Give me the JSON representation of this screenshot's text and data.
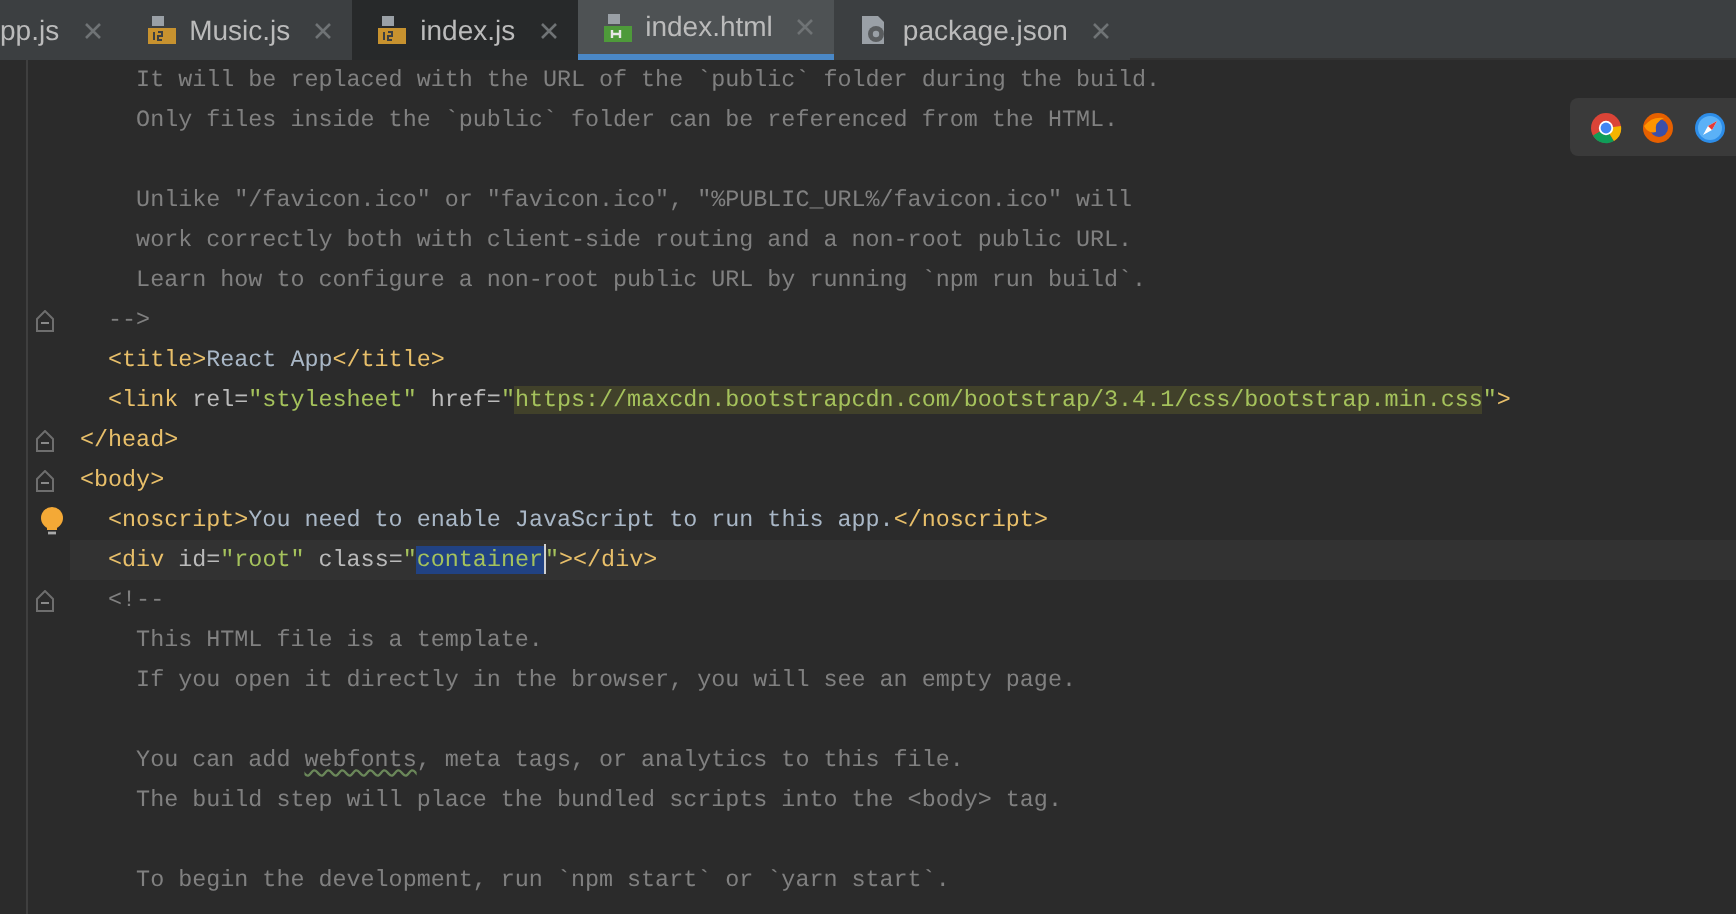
{
  "tabs": [
    {
      "label": "pp.js",
      "kind": "plain",
      "selected": false,
      "hovered": false
    },
    {
      "label": "Music.js",
      "kind": "js",
      "selected": false,
      "hovered": false
    },
    {
      "label": "index.js",
      "kind": "js",
      "selected": false,
      "hovered": true
    },
    {
      "label": "index.html",
      "kind": "html",
      "selected": true,
      "hovered": false
    },
    {
      "label": "package.json",
      "kind": "json",
      "selected": false,
      "hovered": false
    }
  ],
  "lines": [
    {
      "kind": "code",
      "segments": [
        {
          "kind": "comment",
          "text": "    It will be replaced with the URL of the `public` folder during the build."
        }
      ]
    },
    {
      "kind": "code",
      "segments": [
        {
          "kind": "comment",
          "text": "    Only files inside the `public` folder can be referenced from the HTML."
        }
      ]
    },
    {
      "kind": "blank"
    },
    {
      "kind": "code",
      "segments": [
        {
          "kind": "comment",
          "text": "    Unlike \"/favicon.ico\" or \"favicon.ico\", \"%PUBLIC_URL%/favicon.ico\" will"
        }
      ]
    },
    {
      "kind": "code",
      "segments": [
        {
          "kind": "comment",
          "text": "    work correctly both with client-side routing and a non-root public URL."
        }
      ]
    },
    {
      "kind": "code",
      "segments": [
        {
          "kind": "comment",
          "text": "    Learn how to configure a non-root public URL by running `npm run build`."
        }
      ]
    },
    {
      "kind": "fold",
      "segments": [
        {
          "kind": "comment",
          "text": "  -->"
        }
      ]
    },
    {
      "kind": "code",
      "segments": [
        {
          "kind": "tag",
          "text": "  <title>"
        },
        {
          "kind": "text",
          "text": "React App"
        },
        {
          "kind": "tag",
          "text": "</title>"
        }
      ]
    },
    {
      "kind": "code",
      "segments": [
        {
          "kind": "tag",
          "text": "  <link "
        },
        {
          "kind": "attr",
          "text": "rel="
        },
        {
          "kind": "value",
          "text": "\"stylesheet\" "
        },
        {
          "kind": "attr",
          "text": "href="
        },
        {
          "kind": "value",
          "text": "\""
        },
        {
          "kind": "highlight",
          "text": "https://maxcdn.bootstrapcdn.com/bootstrap/3.4.1/css/bootstrap.min.css"
        },
        {
          "kind": "value",
          "text": "\""
        },
        {
          "kind": "tag",
          "text": ">"
        }
      ]
    },
    {
      "kind": "fold",
      "segments": [
        {
          "kind": "tag",
          "text": "</head>"
        }
      ]
    },
    {
      "kind": "fold",
      "segments": [
        {
          "kind": "tag",
          "text": "<body>"
        }
      ]
    },
    {
      "kind": "hint",
      "segments": [
        {
          "kind": "tag",
          "text": "  <noscript>"
        },
        {
          "kind": "text",
          "text": "You need to enable JavaScript to run this app."
        },
        {
          "kind": "tag",
          "text": "</noscript>"
        }
      ]
    },
    {
      "kind": "code",
      "current": true,
      "segments": [
        {
          "kind": "tag",
          "text": "  <div "
        },
        {
          "kind": "attr",
          "text": "id="
        },
        {
          "kind": "value",
          "text": "\"root\" "
        },
        {
          "kind": "attr",
          "text": "class="
        },
        {
          "kind": "value",
          "text": "\""
        },
        {
          "kind": "selected",
          "text": "container"
        },
        {
          "kind": "value",
          "text": "\""
        },
        {
          "kind": "tag",
          "text": "></div>"
        }
      ]
    },
    {
      "kind": "fold",
      "segments": [
        {
          "kind": "comment",
          "text": "  <!--"
        }
      ]
    },
    {
      "kind": "code",
      "segments": [
        {
          "kind": "comment",
          "text": "    This HTML file is a template."
        }
      ]
    },
    {
      "kind": "code",
      "segments": [
        {
          "kind": "comment",
          "text": "    If you open it directly in the browser, you will see an empty page."
        }
      ]
    },
    {
      "kind": "blank"
    },
    {
      "kind": "code",
      "segments": [
        {
          "kind": "comment",
          "text": "    You can add "
        },
        {
          "kind": "typo",
          "text": "webfonts"
        },
        {
          "kind": "comment",
          "text": ", meta tags, or analytics to this file."
        }
      ]
    },
    {
      "kind": "code",
      "segments": [
        {
          "kind": "comment",
          "text": "    The build step will place the bundled scripts into the <body> tag."
        }
      ]
    },
    {
      "kind": "blank"
    },
    {
      "kind": "code",
      "segments": [
        {
          "kind": "comment",
          "text": "    To begin the development, run `npm start` or `yarn start`."
        }
      ]
    }
  ]
}
